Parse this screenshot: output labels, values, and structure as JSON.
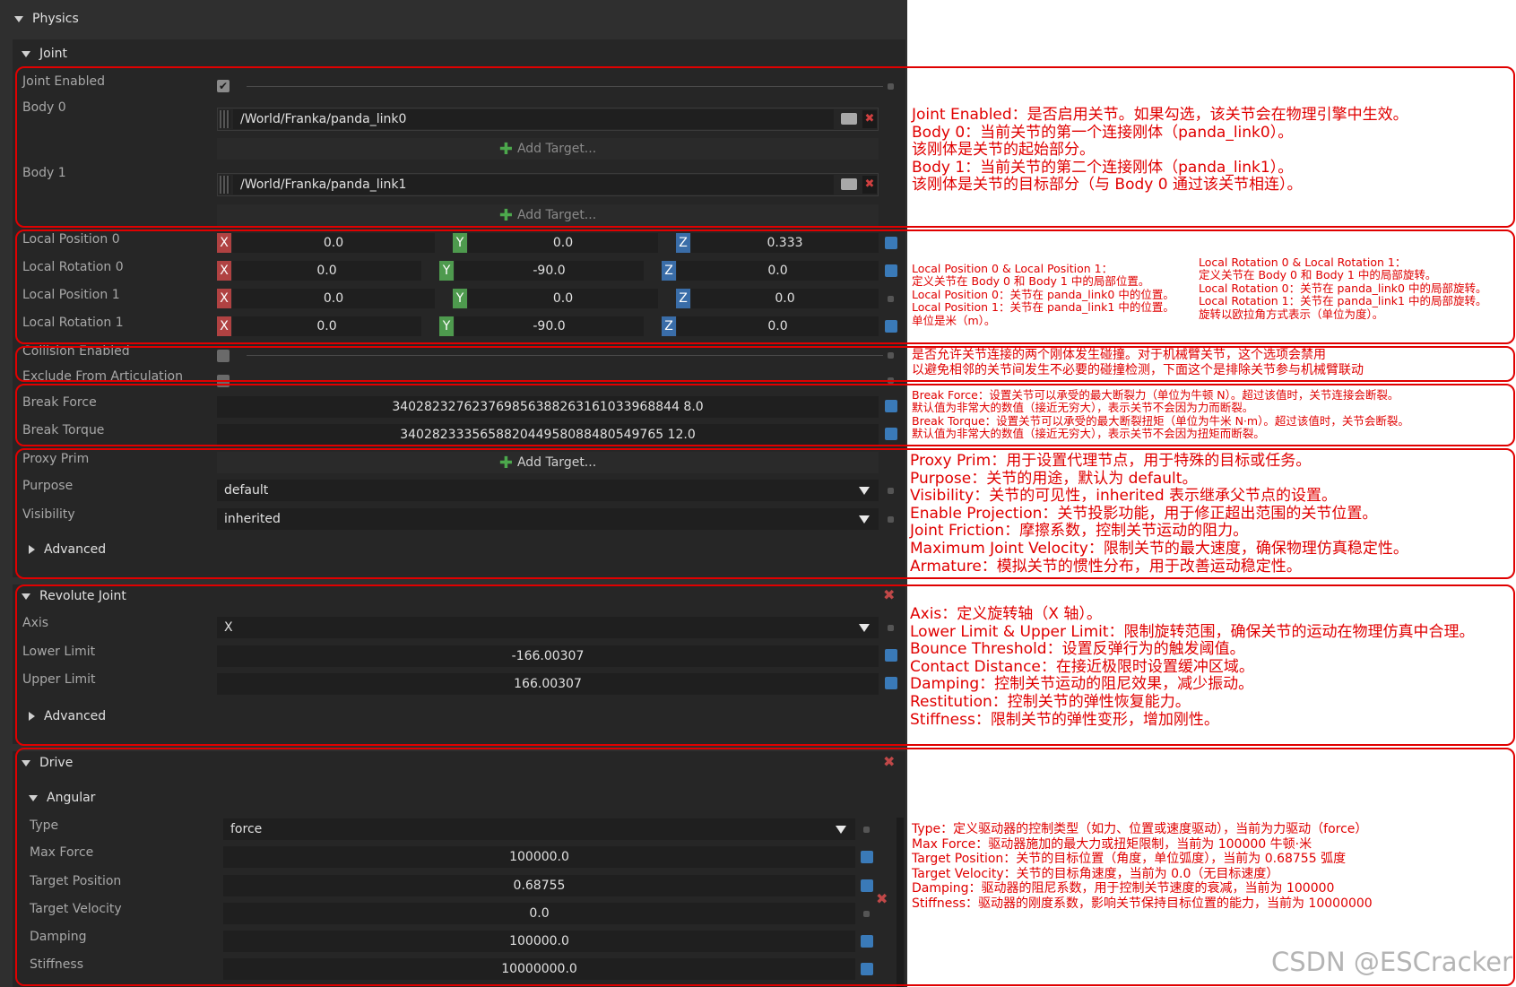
{
  "physics": {
    "title": "Physics"
  },
  "joint": {
    "title": "Joint",
    "joint_enabled_label": "Joint Enabled",
    "body0_label": "Body 0",
    "body0_path": "/World/Franka/panda_link0",
    "body1_label": "Body 1",
    "body1_path": "/World/Franka/panda_link1",
    "add_target": "Add Target...",
    "vectors": [
      {
        "label": "Local Position 0",
        "x": "0.0",
        "y": "0.0",
        "z": "0.333"
      },
      {
        "label": "Local Rotation 0",
        "x": "0.0",
        "y": "-90.0",
        "z": "0.0"
      },
      {
        "label": "Local Position 1",
        "x": "0.0",
        "y": "0.0",
        "z": "0.0"
      },
      {
        "label": "Local Rotation 1",
        "x": "0.0",
        "y": "-90.0",
        "z": "0.0"
      }
    ],
    "axis_tags": {
      "x": "X",
      "y": "Y",
      "z": "Z"
    },
    "collision_enabled_label": "Collision Enabled",
    "exclude_label": "Exclude From Articulation",
    "break_force_label": "Break Force",
    "break_force": "340282327623769856388263161033968844 8.0",
    "break_torque_label": "Break Torque",
    "break_torque": "340282333565882044958088480549765 12.0",
    "proxy_prim_label": "Proxy Prim",
    "purpose_label": "Purpose",
    "purpose": "default",
    "visibility_label": "Visibility",
    "visibility": "inherited",
    "advanced": "Advanced"
  },
  "revolute": {
    "title": "Revolute Joint",
    "axis_label": "Axis",
    "axis": "X",
    "lower_label": "Lower Limit",
    "lower": "-166.00307",
    "upper_label": "Upper Limit",
    "upper": "166.00307",
    "advanced": "Advanced"
  },
  "drive": {
    "title": "Drive",
    "angular": "Angular",
    "type_label": "Type",
    "type": "force",
    "rows": [
      {
        "label": "Max Force",
        "value": "100000.0"
      },
      {
        "label": "Target Position",
        "value": "0.68755"
      },
      {
        "label": "Target Velocity",
        "value": "0.0"
      },
      {
        "label": "Damping",
        "value": "100000.0"
      },
      {
        "label": "Stiffness",
        "value": "10000000.0"
      }
    ]
  },
  "annotations": {
    "a1": [
      "Joint Enabled：是否启用关节。如果勾选，该关节会在物理引擎中生效。",
      "Body 0：当前关节的第一个连接刚体（panda_link0）。",
      "该刚体是关节的起始部分。",
      "Body 1：当前关节的第二个连接刚体（panda_link1）。",
      "该刚体是关节的目标部分（与 Body 0 通过该关节相连）。"
    ],
    "a2_left": [
      "Local Position 0 & Local Position 1：",
      "定义关节在 Body 0 和 Body 1 中的局部位置。",
      "Local Position 0：关节在 panda_link0 中的位置。",
      "Local Position 1：关节在 panda_link1 中的位置。",
      "单位是米（m）。"
    ],
    "a2_right": [
      "Local Rotation 0 & Local Rotation 1：",
      "定义关节在 Body 0 和 Body 1 中的局部旋转。",
      "Local Rotation 0：关节在 panda_link0 中的局部旋转。",
      "Local Rotation 1：关节在 panda_link1 中的局部旋转。",
      "旋转以欧拉角方式表示（单位为度）。"
    ],
    "a3": [
      "是否允许关节连接的两个刚体发生碰撞。对于机械臂关节，这个选项会禁用",
      "以避免相邻的关节间发生不必要的碰撞检测，下面这个是排除关节参与机械臂联动"
    ],
    "a4": [
      "Break Force：设置关节可以承受的最大断裂力（单位为牛顿 N）。超过该值时，关节连接会断裂。",
      "默认值为非常大的数值（接近无穷大），表示关节不会因为力而断裂。",
      "Break Torque：设置关节可以承受的最大断裂扭矩（单位为牛米 N·m）。超过该值时，关节会断裂。",
      "默认值为非常大的数值（接近无穷大），表示关节不会因为扭矩而断裂。"
    ],
    "a5": [
      "Proxy Prim：用于设置代理节点，用于特殊的目标或任务。",
      "Purpose：关节的用途，默认为 default。",
      "Visibility：关节的可见性，inherited 表示继承父节点的设置。",
      "Enable Projection：关节投影功能，用于修正超出范围的关节位置。",
      "Joint Friction：摩擦系数，控制关节运动的阻力。",
      "Maximum Joint Velocity：限制关节的最大速度，确保物理仿真稳定性。",
      "Armature：模拟关节的惯性分布，用于改善运动稳定性。"
    ],
    "a6": [
      "Axis：定义旋转轴（X 轴）。",
      "Lower Limit & Upper Limit：限制旋转范围，确保关节的运动在物理仿真中合理。",
      "Bounce Threshold：设置反弹行为的触发阈值。",
      "Contact Distance：在接近极限时设置缓冲区域。",
      "Damping：控制关节运动的阻尼效果，减少振动。",
      "Restitution：控制关节的弹性恢复能力。",
      "Stiffness：限制关节的弹性变形，增加刚性。"
    ],
    "a7": [
      "Type：定义驱动器的控制类型（如力、位置或速度驱动），当前为力驱动（force）",
      "Max Force：驱动器施加的最大力或扭矩限制，当前为 100000 牛顿·米",
      "Target Position：关节的目标位置（角度，单位弧度），当前为 0.68755 弧度",
      "Target Velocity：关节的目标角速度，当前为 0.0（无目标速度）",
      "Damping：驱动器的阻尼系数，用于控制关节速度的衰减，当前为 100000",
      "Stiffness：驱动器的刚度系数，影响关节保持目标位置的能力，当前为 10000000"
    ],
    "watermark": "CSDN @ESCracker"
  },
  "colors": {
    "annotation": "#e00000",
    "panel": "#2f2f2f",
    "field": "#1f1f1f"
  }
}
